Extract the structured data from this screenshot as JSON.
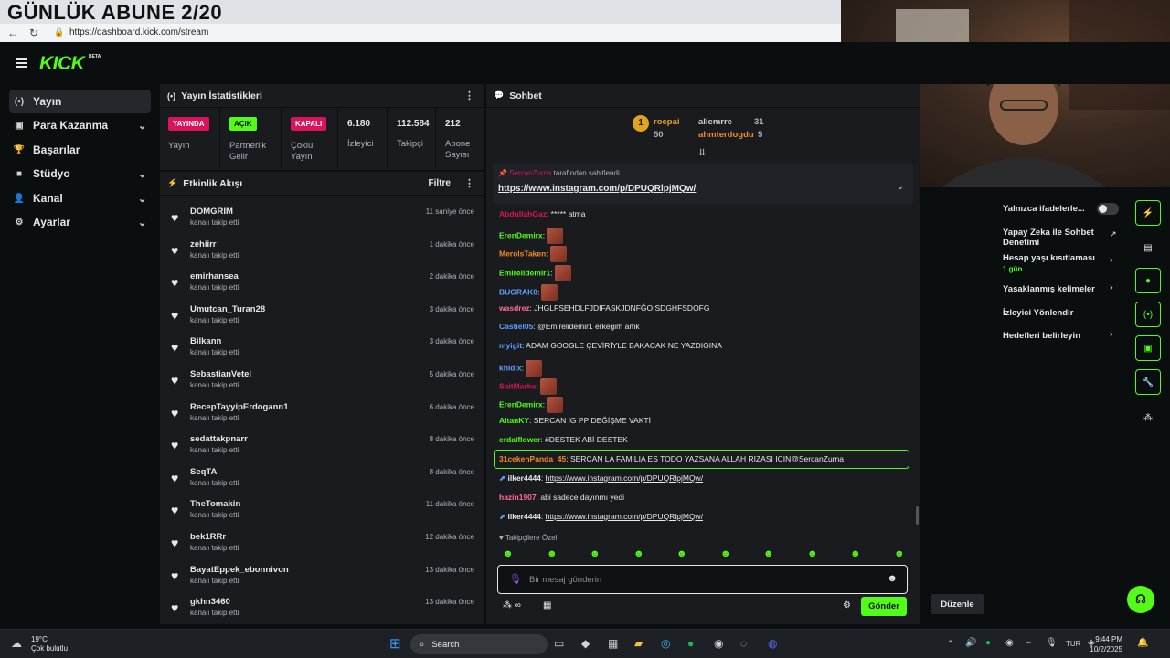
{
  "overlay_title": "GÜNLÜK ABUNE 2/20",
  "browser": {
    "url": "https://dashboard.kick.com/stream"
  },
  "brand": {
    "logo": "KICK",
    "beta": "BETA",
    "accent": "#53fc18"
  },
  "sidebar": {
    "items": [
      {
        "label": "Yayın",
        "icon": "broadcast-icon",
        "active": true
      },
      {
        "label": "Para Kazanma",
        "icon": "dollar-icon",
        "chevron": true
      },
      {
        "label": "Başarılar",
        "icon": "trophy-icon"
      },
      {
        "label": "Stüdyo",
        "icon": "video-icon",
        "chevron": true
      },
      {
        "label": "Kanal",
        "icon": "user-icon",
        "chevron": true
      },
      {
        "label": "Ayarlar",
        "icon": "gear-icon",
        "chevron": true
      }
    ]
  },
  "stats": {
    "title": "Yayın İstatistikleri",
    "cols": [
      {
        "badge": "YAYINDA",
        "label": "Yayın"
      },
      {
        "badge": "AÇIK",
        "label": "Partnerlik Gelir"
      },
      {
        "badge": "KAPALI",
        "label": "Çoklu Yayın"
      },
      {
        "value": "6.180",
        "label": "İzleyici"
      },
      {
        "value": "112.584",
        "label": "Takipçi"
      },
      {
        "value": "212",
        "label": "Abone Sayısı"
      }
    ]
  },
  "activity": {
    "title": "Etkinlik Akışı",
    "filter": "Filtre",
    "items": [
      {
        "name": "DOMGRIM",
        "sub": "kanalı takip etti",
        "time": "11 saniye önce"
      },
      {
        "name": "zehiirr",
        "sub": "kanalı takip etti",
        "time": "1 dakika önce"
      },
      {
        "name": "emirhansea",
        "sub": "kanalı takip etti",
        "time": "2 dakika önce"
      },
      {
        "name": "Umutcan_Turan28",
        "sub": "kanalı takip etti",
        "time": "3 dakika önce"
      },
      {
        "name": "Bilkann",
        "sub": "kanalı takip etti",
        "time": "3 dakika önce"
      },
      {
        "name": "SebastianVetel",
        "sub": "kanalı takip etti",
        "time": "5 dakika önce"
      },
      {
        "name": "RecepTayyipErdogann1",
        "sub": "kanalı takip etti",
        "time": "6 dakika önce"
      },
      {
        "name": "sedattakpnarr",
        "sub": "kanalı takip etti",
        "time": "8 dakika önce"
      },
      {
        "name": "SeqTA",
        "sub": "kanalı takip etti",
        "time": "8 dakika önce"
      },
      {
        "name": "TheTomakin",
        "sub": "kanalı takip etti",
        "time": "11 dakika önce"
      },
      {
        "name": "bek1RRr",
        "sub": "kanalı takip etti",
        "time": "12 dakika önce"
      },
      {
        "name": "BayatEppek_ebonnivon",
        "sub": "kanalı takip etti",
        "time": "13 dakika önce"
      },
      {
        "name": "gkhn3460",
        "sub": "kanalı takip etti",
        "time": "13 dakika önce"
      }
    ]
  },
  "chat": {
    "title": "Sohbet",
    "podium": [
      {
        "rank": "1",
        "name": "rocpai",
        "count": "50"
      },
      {
        "name": "aliemrre",
        "count": "31"
      },
      {
        "name": "ahmterdogdu",
        "count": "5"
      }
    ],
    "pinned": {
      "by": "SercanZurna",
      "by_suffix": "tarafından sabitlendi",
      "link": "https://www.instagram.com/p/DPUQRlpjMQw/"
    },
    "messages": [
      {
        "user": "AbdullahGaz",
        "color": "#d9145b",
        "text": ": ***** atma"
      },
      {
        "user": "ErenDemirx",
        "color": "#53fc18",
        "text": ":",
        "emote": true
      },
      {
        "user": "MerolsTaken",
        "color": "#f08a24",
        "text": ":",
        "emote": true
      },
      {
        "user": "Emirelidemir1",
        "color": "#53fc18",
        "text": ":",
        "emote": true
      },
      {
        "user": "BUGRAK0",
        "color": "#5ea0ff",
        "text": ":",
        "emote": true
      },
      {
        "user": "wasdrez",
        "color": "#ff6b9a",
        "text": ": JHGLFSEHDLFJDIFASKJDNFĞOISDGHFSDOFG"
      },
      {
        "user": "Castiel05",
        "color": "#5ea0ff",
        "text": ": @Emirelidemir1 erkeğim amk"
      },
      {
        "user": "myigit",
        "color": "#5ea0ff",
        "text": ": ADAM GOOGLE ÇEVİRİYLE BAKACAK NE YAZDIGINA"
      },
      {
        "user": "khidix",
        "color": "#5ea0ff",
        "text": ":",
        "emote": true
      },
      {
        "user": "SaitMarko",
        "color": "#d9145b",
        "text": ":",
        "emote": true
      },
      {
        "user": "ErenDemirx",
        "color": "#53fc18",
        "text": ":",
        "emote": true
      },
      {
        "user": "AltanKY",
        "color": "#53fc18",
        "text": ": SERCAN İG PP DEĞİŞME VAKTİ"
      },
      {
        "user": "erdalflower",
        "color": "#53fc18",
        "text": ": #DESTEK ABİ DESTEK"
      },
      {
        "user": "31cekenPanda_45",
        "color": "#f08a24",
        "text": ": SERCAN LA FAMILIA ES TODO YAZSANA ALLAH RIZASI ICIN@SercanZurna"
      },
      {
        "user": "ilker4444",
        "color": "#e6e8ea",
        "text": ":",
        "link": "https://www.instagram.com/p/DPUQRlpjMQw/"
      },
      {
        "user": "hazin1907",
        "color": "#ff6b9a",
        "text": ": abi sadece dayınmı yedi"
      },
      {
        "user": "ilker4444",
        "color": "#e6e8ea",
        "text": ":",
        "link": "https://www.instagram.com/p/DPUQRlpjMQw/"
      }
    ],
    "followers_only": "Takipçilere Özel",
    "input_placeholder": "Bir mesaj gönderin",
    "send_label": "Gönder"
  },
  "right_settings": {
    "items": [
      {
        "label": "Yalnızca ifadelerle..."
      },
      {
        "label": "Yapay Zeka ile Sohbet Denetimi"
      },
      {
        "label": "Hesap yaşı kısıtlaması",
        "sub": "1 gün"
      },
      {
        "label": "Yasaklanmış kelimeler"
      },
      {
        "label": "İzleyici Yönlendir"
      },
      {
        "label": "Hedefleri belirleyin"
      }
    ],
    "edit_label": "Düzenle"
  },
  "taskbar": {
    "weather_temp": "19°C",
    "weather_desc": "Çok bulutlu",
    "search": "Search",
    "lang": "TUR",
    "time": "9:44 PM",
    "date": "10/2/2025"
  }
}
